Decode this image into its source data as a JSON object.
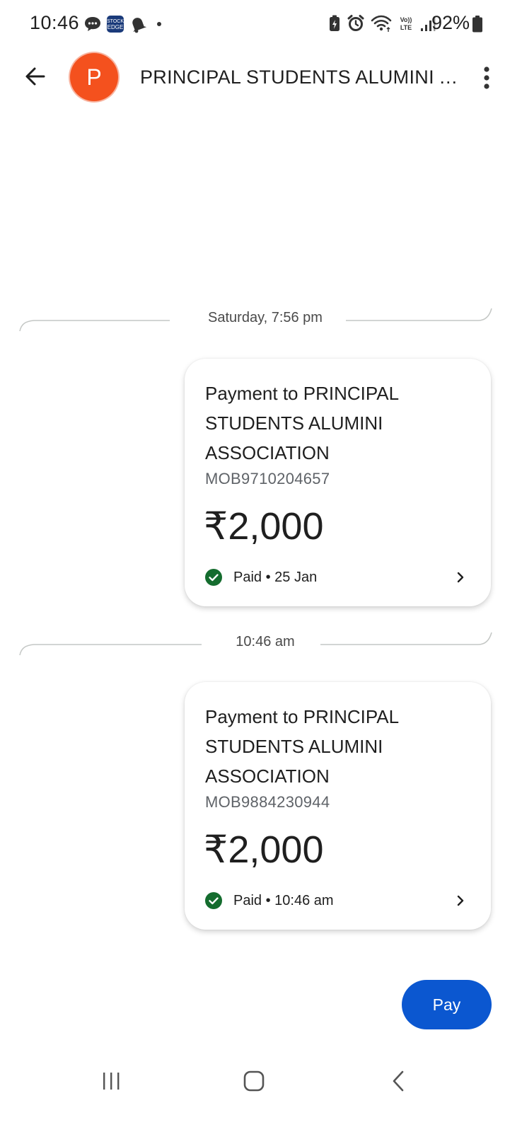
{
  "status_bar": {
    "time": "10:46",
    "notification_icons": [
      "chat-bubble-icon",
      "stock-edge-app-icon",
      "bell-icon"
    ],
    "system_icons": [
      "battery-saver-icon",
      "alarm-icon",
      "wifi-icon",
      "volte-icon",
      "signal-icon"
    ],
    "volte_label_top": "Vo))",
    "volte_label_bottom": "LTE",
    "app_badge_top": "STOCK",
    "app_badge_bottom": "EDGE",
    "battery": "92%"
  },
  "header": {
    "avatar_initial": "P",
    "avatar_color": "#f4511e",
    "contact_name": "PRINCIPAL STUDENTS ALUMINI ASSOCIATION"
  },
  "messages": [
    {
      "date_label": "Saturday, 7:56 pm",
      "title": "Payment to PRINCIPAL STUDENTS ALUMINI ASSOCIATION",
      "reference": "MOB9710204657",
      "amount": "₹2,000",
      "status": "Paid • 25 Jan"
    },
    {
      "date_label": "10:46 am",
      "title": "Payment to PRINCIPAL STUDENTS ALUMINI ASSOCIATION",
      "reference": "MOB9884230944",
      "amount": "₹2,000",
      "status": "Paid • 10:46 am"
    }
  ],
  "pay_button": {
    "label": "Pay",
    "color": "#0b57d0"
  },
  "nav": {
    "items": [
      "recent-apps-icon",
      "home-icon",
      "back-icon"
    ]
  },
  "colors": {
    "paid_green": "#146c2e",
    "divider": "#c4c7c5"
  }
}
